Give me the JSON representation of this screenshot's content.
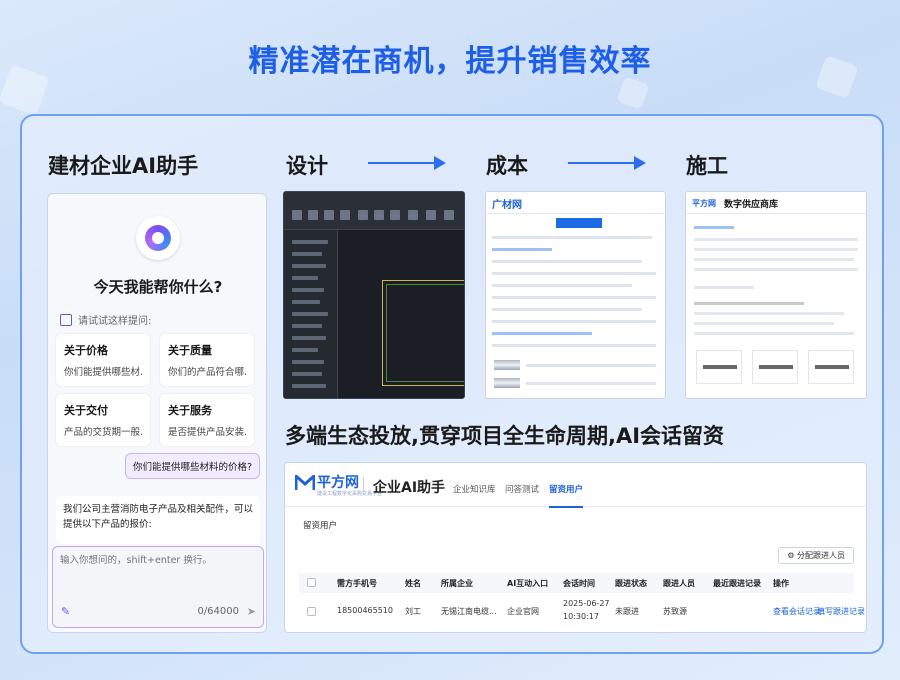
{
  "headline": "精准潜在商机，提升销售效率",
  "sections": {
    "assistant": "建材企业AI助手",
    "design": "设计",
    "cost": "成本",
    "construction": "施工",
    "ecosystem": "多端生态投放,贯穿项目全生命周期,AI会话留资"
  },
  "chat": {
    "greeting": "今天我能帮你什么?",
    "hint": "请试试这样提问:",
    "cards": [
      {
        "title": "关于价格",
        "desc": "你们能提供哪些材..."
      },
      {
        "title": "关于质量",
        "desc": "你们的产品符合哪..."
      },
      {
        "title": "关于交付",
        "desc": "产品的交货期一般..."
      },
      {
        "title": "关于服务",
        "desc": "是否提供产品安装..."
      }
    ],
    "user_message": "你们能提供哪些材料的价格?",
    "bot_message": "我们公司主营消防电子产品及相关配件，可以提供以下产品的报价:",
    "input_placeholder": "输入你想问的，shift+enter 换行。",
    "counter": "0/64000"
  },
  "cost_site": {
    "logo": "广材网"
  },
  "supply_site": {
    "logo": "平方网",
    "title": "数字供应商库"
  },
  "admin": {
    "logo": "平方网",
    "logo_sub": "建设工程数字化采购交易平台",
    "title": "企业AI助手",
    "nav": [
      "企业知识库",
      "问答测试",
      "留资用户"
    ],
    "active_nav": "留资用户",
    "section": "留资用户",
    "assign_button": "分配跟进人员",
    "columns": [
      "需方手机号",
      "姓名",
      "所属企业",
      "AI互动入口",
      "会话时间",
      "跟进状态",
      "跟进人员",
      "最近跟进记录",
      "操作"
    ],
    "row": {
      "phone": "18500465510",
      "name": "刘工",
      "company": "无锡江南电缆...",
      "entry": "企业官网",
      "date": "2025-06-27",
      "time": "10:30:17",
      "status": "未跟进",
      "follower": "苏致源",
      "record": "",
      "action_view": "查看会话记录",
      "action_fill": "填写跟进记录"
    }
  },
  "colors": {
    "accent": "#1f5fe8",
    "panel_border": "#6ea2ee",
    "chat_accent": "#7b4df0"
  }
}
